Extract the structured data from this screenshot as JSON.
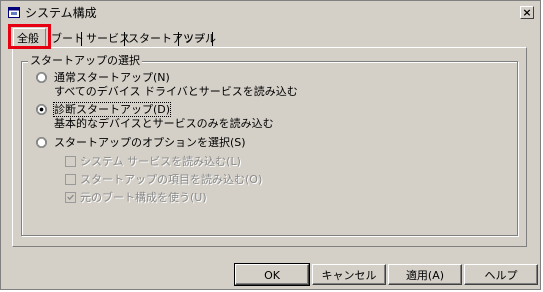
{
  "window": {
    "title": "システム構成",
    "close_glyph": "×"
  },
  "tabs": [
    {
      "label": "全般"
    },
    {
      "label": "ブート"
    },
    {
      "label": "サービス"
    },
    {
      "label": "スタートアップ"
    },
    {
      "label": "ツール"
    }
  ],
  "group": {
    "label": "スタートアップの選択",
    "options": [
      {
        "label": "通常スタートアップ(N)",
        "description": "すべてのデバイス ドライバとサービスを読み込む",
        "selected": false
      },
      {
        "label": "診断スタートアップ(D)",
        "description": "基本的なデバイスとサービスのみを読み込む",
        "selected": true
      },
      {
        "label": "スタートアップのオプションを選択(S)",
        "description": "",
        "selected": false
      }
    ],
    "checkboxes": [
      {
        "label": "システム サービスを読み込む(L)",
        "checked": false
      },
      {
        "label": "スタートアップの項目を読み込む(O)",
        "checked": false
      },
      {
        "label": "元のブート構成を使う(U)",
        "checked": true
      }
    ]
  },
  "buttons": {
    "ok": "OK",
    "cancel": "キャンセル",
    "apply": "適用(A)",
    "help": "ヘルプ"
  },
  "colors": {
    "highlight": "#e60012",
    "face": "#d4d0c8"
  }
}
